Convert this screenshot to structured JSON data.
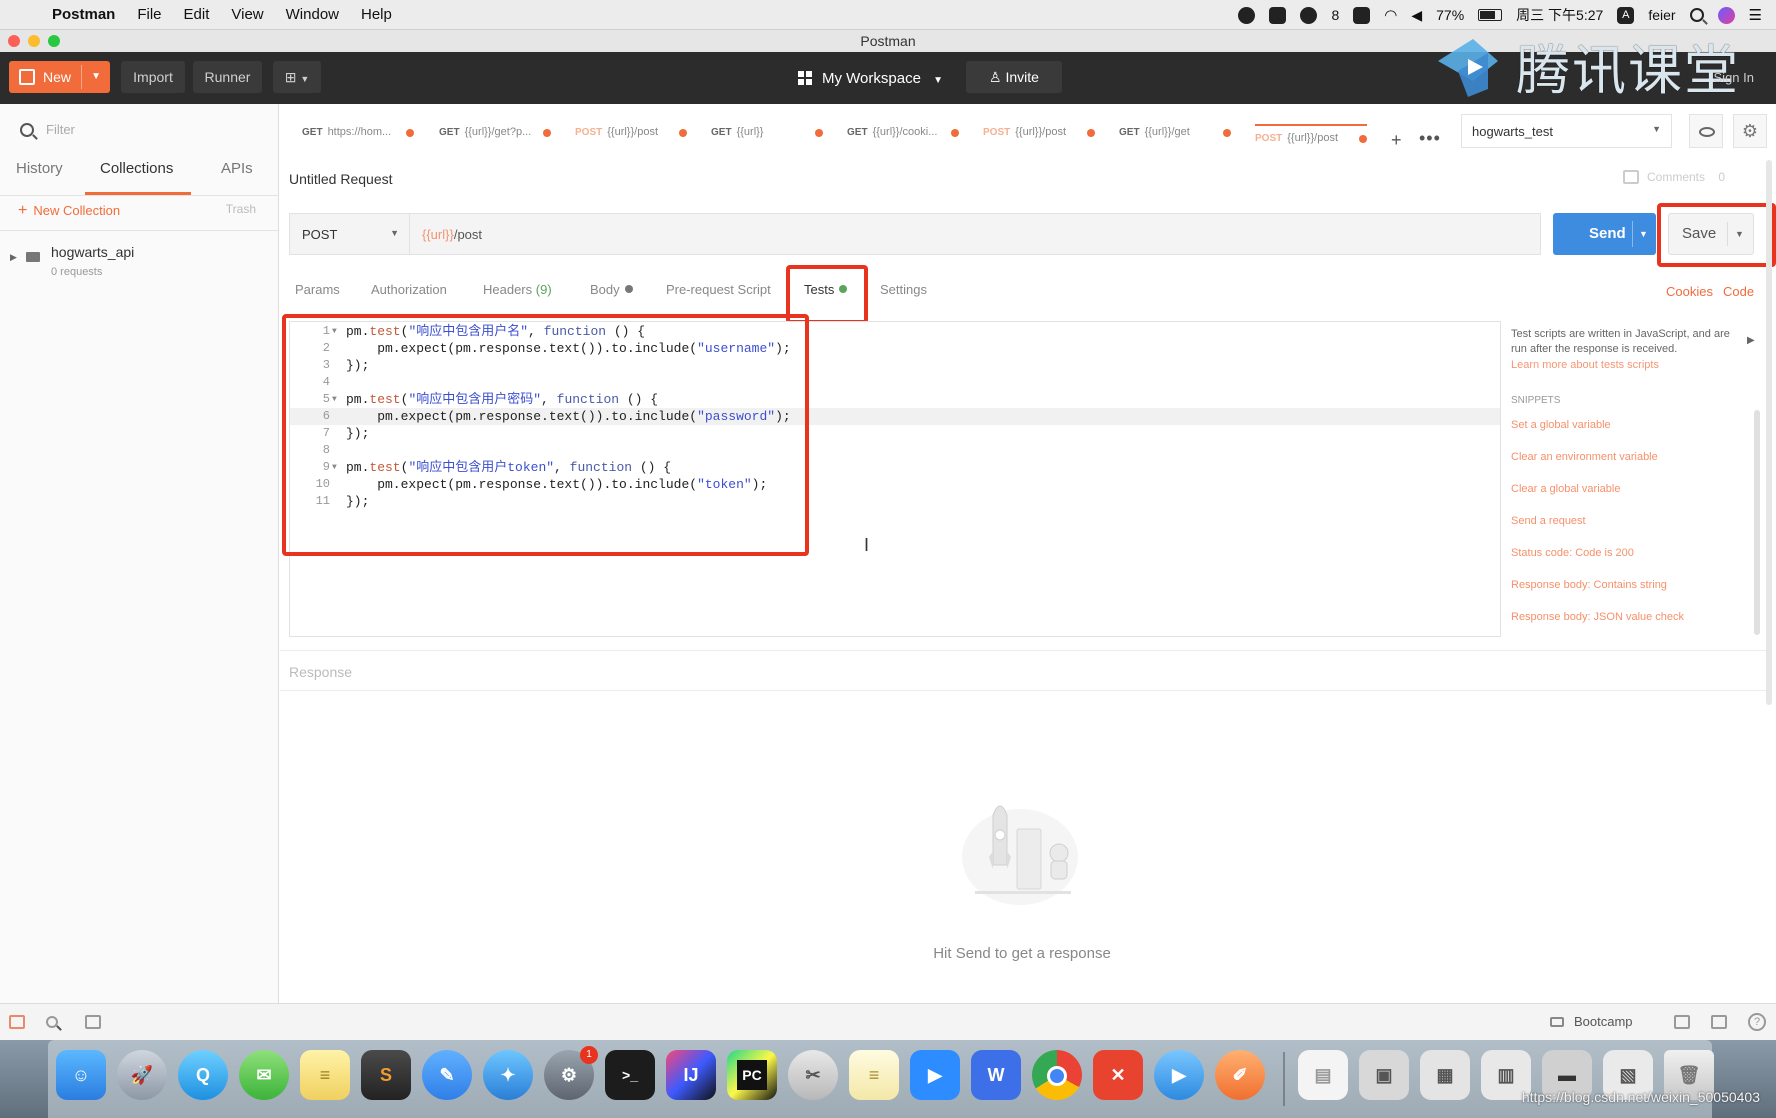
{
  "menubar": {
    "app_name": "Postman",
    "items": [
      "File",
      "Edit",
      "View",
      "Window",
      "Help"
    ],
    "wechat_badge": "8",
    "battery": "77%",
    "clock": "周三 下午5:27",
    "user": "feier"
  },
  "window": {
    "title": "Postman"
  },
  "header": {
    "new_label": "New",
    "import_label": "Import",
    "runner_label": "Runner",
    "workspace_label": "My Workspace",
    "invite_label": "Invite",
    "watermark_text": "腾讯课堂",
    "signin_label": "Sign In"
  },
  "sidebar": {
    "filter_placeholder": "Filter",
    "tabs": [
      "History",
      "Collections",
      "APIs"
    ],
    "active_tab": "Collections",
    "new_collection_label": "New Collection",
    "trash_label": "Trash",
    "collections": [
      {
        "name": "hogwarts_api",
        "meta": "0 requests"
      }
    ]
  },
  "request_tabs": [
    {
      "method": "GET",
      "label": "https://hom..."
    },
    {
      "method": "GET",
      "label": "{{url}}/get?p..."
    },
    {
      "method": "POST",
      "label": "{{url}}/post"
    },
    {
      "method": "GET",
      "label": "{{url}}"
    },
    {
      "method": "GET",
      "label": "{{url}}/cooki..."
    },
    {
      "method": "POST",
      "label": "{{url}}/post"
    },
    {
      "method": "GET",
      "label": "{{url}}/get"
    },
    {
      "method": "POST",
      "label": "{{url}}/post"
    }
  ],
  "environment": {
    "selected": "hogwarts_test"
  },
  "request": {
    "name": "Untitled Request",
    "comments_label": "Comments",
    "comments_count": "0",
    "method": "POST",
    "url_var": "{{url}}",
    "url_path": "/post",
    "send_label": "Send",
    "save_label": "Save"
  },
  "subtabs": {
    "params": "Params",
    "authorization": "Authorization",
    "headers": "Headers",
    "headers_count": "(9)",
    "body": "Body",
    "prerequest": "Pre-request Script",
    "tests": "Tests",
    "settings": "Settings",
    "cookies": "Cookies",
    "code": "Code"
  },
  "editor": {
    "line_numbers": [
      "1",
      "2",
      "3",
      "4",
      "5",
      "6",
      "7",
      "8",
      "9",
      "10",
      "11"
    ],
    "l1_a": "pm.",
    "l1_b": "test",
    "l1_c": "(",
    "l1_d": "\"响应中包含用户名\"",
    "l1_e": ", ",
    "l1_f": "function",
    "l1_g": " () {",
    "l2_a": "    pm.expect(pm.response.text()).to.include(",
    "l2_b": "\"username\"",
    "l2_c": ");",
    "l3": "});",
    "l5_a": "pm.",
    "l5_b": "test",
    "l5_c": "(",
    "l5_d": "\"响应中包含用户密码\"",
    "l5_e": ", ",
    "l5_f": "function",
    "l5_g": " () {",
    "l6_a": "    pm.expect(pm.response.text()).to.include(",
    "l6_b": "\"password\"",
    "l6_c": ");",
    "l7": "});",
    "l9_a": "pm.",
    "l9_b": "test",
    "l9_c": "(",
    "l9_d": "\"响应中包含用户token\"",
    "l9_e": ", ",
    "l9_f": "function",
    "l9_g": " () {",
    "l10_a": "    pm.expect(pm.response.text()).to.include(",
    "l10_b": "\"token\"",
    "l10_c": ");",
    "l11": "});"
  },
  "snippets": {
    "intro": "Test scripts are written in JavaScript, and are run after the response is received.",
    "learn_more": "Learn more about tests scripts",
    "heading": "SNIPPETS",
    "items": [
      "Set a global variable",
      "Clear an environment variable",
      "Clear a global variable",
      "Send a request",
      "Status code: Code is 200",
      "Response body: Contains string",
      "Response body: JSON value check"
    ]
  },
  "response": {
    "label": "Response",
    "empty_message": "Hit Send to get a response"
  },
  "statusbar": {
    "bootcamp_label": "Bootcamp"
  },
  "dock": {
    "apps": [
      "finder",
      "launchpad",
      "qq",
      "wechat",
      "stickies",
      "sublime",
      "notes-pen",
      "safari",
      "system-preferences",
      "terminal",
      "intellij",
      "pycharm",
      "script-editor",
      "notes",
      "zoom",
      "wps",
      "chrome",
      "xmind",
      "tencent-classroom",
      "pencil-app",
      "document",
      "preview-1",
      "preview-2",
      "preview-3",
      "preview-4",
      "preview-5",
      "trash"
    ],
    "syspref_badge": "1"
  },
  "url_watermark": "https://blog.csdn.net/weixin_50050403"
}
